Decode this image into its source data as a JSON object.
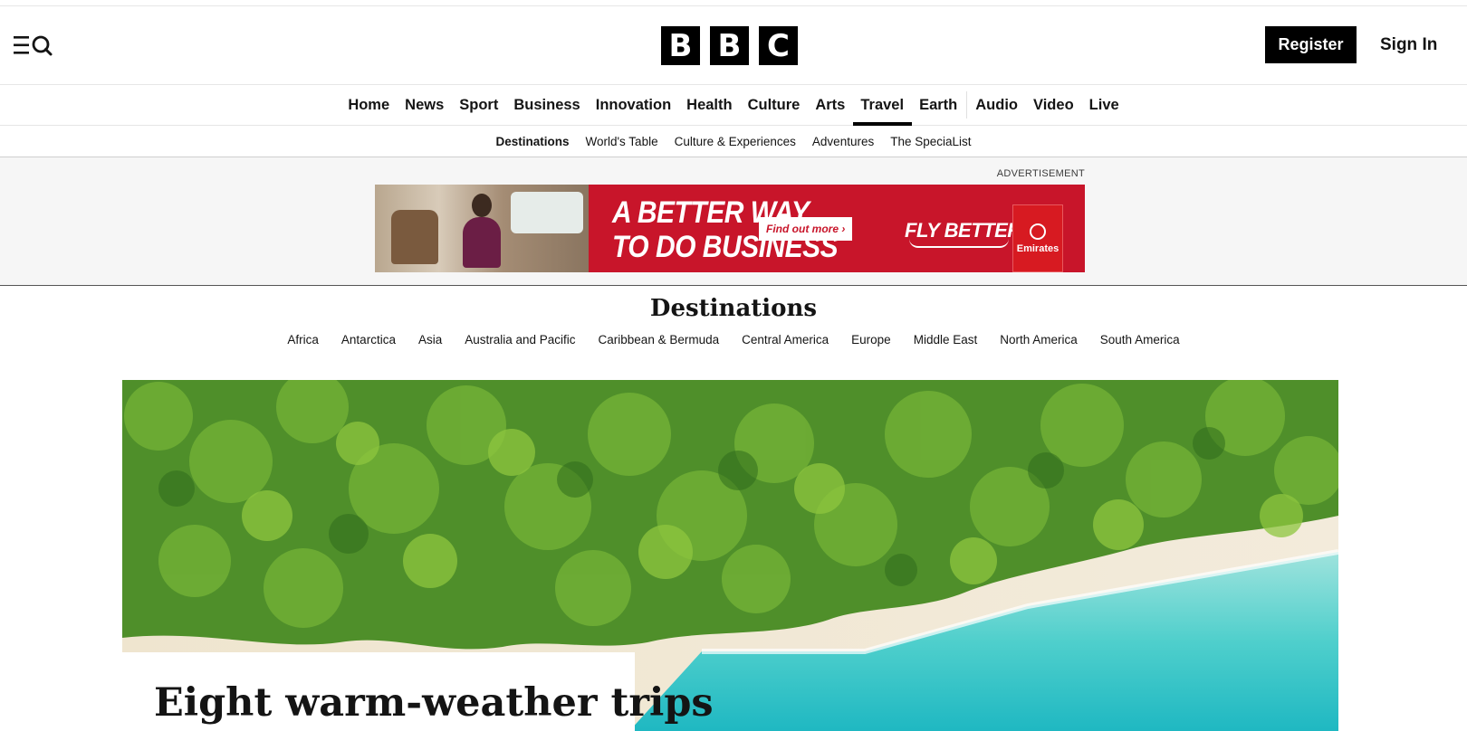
{
  "header": {
    "logo_letters": [
      "B",
      "B",
      "C"
    ],
    "register_label": "Register",
    "signin_label": "Sign In",
    "menu_icon": "menu-search-icon"
  },
  "primary_nav": {
    "items": [
      {
        "label": "Home"
      },
      {
        "label": "News"
      },
      {
        "label": "Sport"
      },
      {
        "label": "Business"
      },
      {
        "label": "Innovation"
      },
      {
        "label": "Health"
      },
      {
        "label": "Culture"
      },
      {
        "label": "Arts"
      },
      {
        "label": "Travel",
        "active": true
      },
      {
        "label": "Earth"
      },
      {
        "label": "Audio"
      },
      {
        "label": "Video"
      },
      {
        "label": "Live"
      }
    ]
  },
  "sub_nav": {
    "items": [
      {
        "label": "Destinations",
        "active": true
      },
      {
        "label": "World's Table"
      },
      {
        "label": "Culture & Experiences"
      },
      {
        "label": "Adventures"
      },
      {
        "label": "The SpeciaList"
      }
    ]
  },
  "ad": {
    "label": "ADVERTISEMENT",
    "headline_line1": "A BETTER WAY",
    "headline_line2": "TO DO BUSINESS",
    "cta": "Find out more ›",
    "tagline": "FLY BETTER",
    "brand": "Emirates",
    "brand_color": "#c8152a"
  },
  "section": {
    "title": "Destinations",
    "regions": [
      "Africa",
      "Antarctica",
      "Asia",
      "Australia and Pacific",
      "Caribbean & Bermuda",
      "Central America",
      "Europe",
      "Middle East",
      "North America",
      "South America"
    ]
  },
  "hero": {
    "headline": "Eight warm-weather trips"
  }
}
